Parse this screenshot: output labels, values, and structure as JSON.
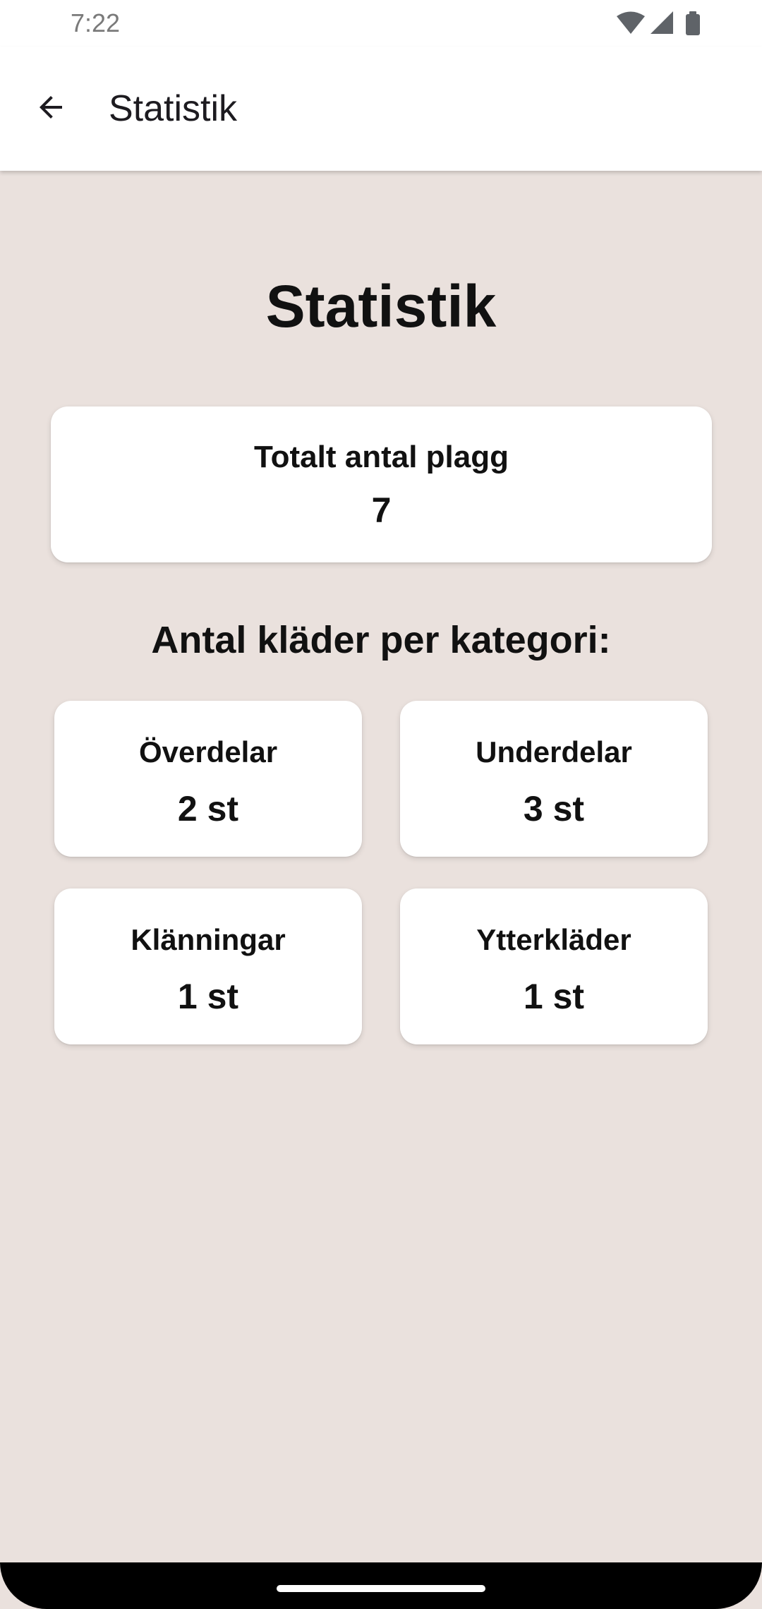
{
  "status_bar": {
    "time": "7:22",
    "icons": [
      "wifi-icon",
      "cellular-signal-icon",
      "battery-icon"
    ]
  },
  "app_bar": {
    "back_icon": "arrow-back-icon",
    "title": "Statistik"
  },
  "main": {
    "title": "Statistik",
    "total": {
      "label": "Totalt antal plagg",
      "value": "7"
    },
    "section_heading": "Antal kläder per kategori:",
    "categories": [
      {
        "label": "Överdelar",
        "value": "2 st"
      },
      {
        "label": "Underdelar",
        "value": "3 st"
      },
      {
        "label": "Klänningar",
        "value": "1 st"
      },
      {
        "label": "Ytterkläder",
        "value": "1 st"
      }
    ]
  },
  "colors": {
    "background": "#EAE1DD",
    "card": "#FFFFFF",
    "app_bar": "#FFFFFF",
    "text": "#111111",
    "nav_bar": "#000000"
  }
}
